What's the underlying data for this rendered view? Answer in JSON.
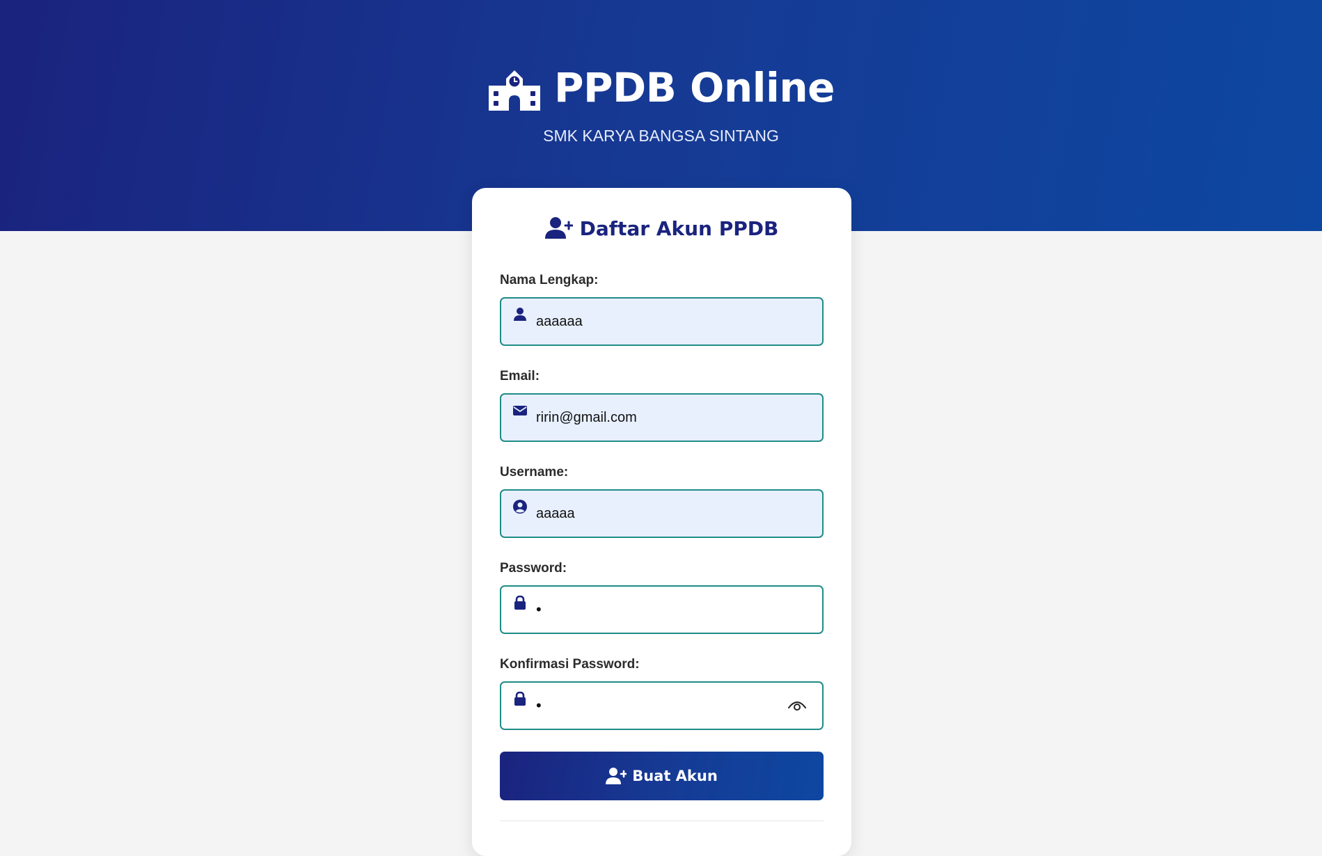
{
  "header": {
    "title": "PPDB Online",
    "subtitle": "SMK KARYA BANGSA SINTANG",
    "icon": "school-icon"
  },
  "form": {
    "title": "Daftar Akun PPDB",
    "title_icon": "user-plus-icon",
    "fields": {
      "nama": {
        "label": "Nama Lengkap:",
        "value": "aaaaaa",
        "icon": "user-icon"
      },
      "email": {
        "label": "Email:",
        "value": "ririn@gmail.com",
        "icon": "envelope-icon"
      },
      "username": {
        "label": "Username:",
        "value": "aaaaa",
        "icon": "user-circle-icon"
      },
      "password": {
        "label": "Password:",
        "value": "•",
        "icon": "lock-icon"
      },
      "konfirmasi": {
        "label": "Konfirmasi Password:",
        "value": "•",
        "icon": "lock-icon",
        "toggle_icon": "eye-icon"
      }
    },
    "submit": {
      "label": "Buat Akun",
      "icon": "user-plus-icon"
    }
  },
  "colors": {
    "primary": "#1a237e",
    "primary_end": "#0d47a1",
    "field_border": "#1e8c86",
    "field_fill": "#e8f0fe",
    "page_bg": "#f4f4f4"
  }
}
